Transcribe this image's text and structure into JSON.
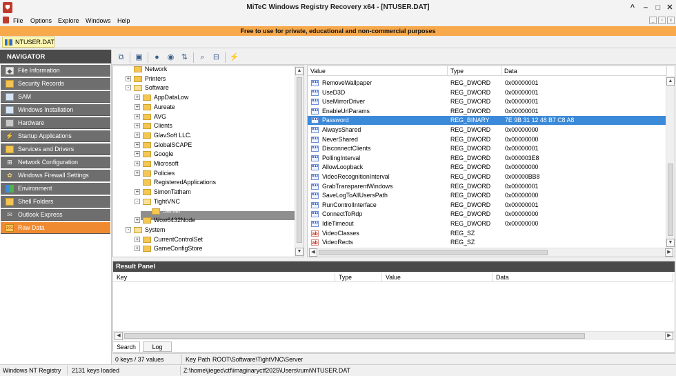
{
  "window": {
    "title": "MiTeC Windows Registry Recovery x64 - [NTUSER.DAT]"
  },
  "menu": [
    "File",
    "Options",
    "Explore",
    "Windows",
    "Help"
  ],
  "banner": "Free to use for private, educational and non-commercial purposes",
  "doc_tab": "NTUSER.DAT",
  "navigator": {
    "title": "NAVIGATOR",
    "items": [
      {
        "label": "File Information",
        "icon": "tag-icon"
      },
      {
        "label": "Security Records",
        "icon": "folder-icon"
      },
      {
        "label": "SAM",
        "icon": "sam-icon"
      },
      {
        "label": "Windows Installation",
        "icon": "monitor-icon"
      },
      {
        "label": "Hardware",
        "icon": "chip-icon"
      },
      {
        "label": "Startup Applications",
        "icon": "lightning-icon"
      },
      {
        "label": "Services and Drivers",
        "icon": "folder-icon"
      },
      {
        "label": "Network Configuration",
        "icon": "network-icon"
      },
      {
        "label": "Windows Firewall Settings",
        "icon": "firewall-icon"
      },
      {
        "label": "Environment",
        "icon": "windows-icon"
      },
      {
        "label": "Shell Folders",
        "icon": "folder-icon"
      },
      {
        "label": "Outlook Express",
        "icon": "mail-icon"
      },
      {
        "label": "Raw Data",
        "icon": "binary-icon",
        "active": true
      }
    ]
  },
  "tree": {
    "rows": [
      {
        "label": "Network",
        "indent": 0,
        "expander": "",
        "open": false
      },
      {
        "label": "Printers",
        "indent": 0,
        "expander": "+",
        "open": false
      },
      {
        "label": "Software",
        "indent": 0,
        "expander": "-",
        "open": true
      },
      {
        "label": "AppDataLow",
        "indent": 1,
        "expander": "+",
        "open": false
      },
      {
        "label": "Aureate",
        "indent": 1,
        "expander": "+",
        "open": false
      },
      {
        "label": "AVG",
        "indent": 1,
        "expander": "+",
        "open": false
      },
      {
        "label": "Clients",
        "indent": 1,
        "expander": "+",
        "open": false
      },
      {
        "label": "GlavSoft LLC.",
        "indent": 1,
        "expander": "+",
        "open": false
      },
      {
        "label": "GlobalSCAPE",
        "indent": 1,
        "expander": "+",
        "open": false
      },
      {
        "label": "Google",
        "indent": 1,
        "expander": "+",
        "open": false
      },
      {
        "label": "Microsoft",
        "indent": 1,
        "expander": "+",
        "open": false
      },
      {
        "label": "Policies",
        "indent": 1,
        "expander": "+",
        "open": false
      },
      {
        "label": "RegisteredApplications",
        "indent": 1,
        "expander": "",
        "open": false
      },
      {
        "label": "SimonTatham",
        "indent": 1,
        "expander": "+",
        "open": false
      },
      {
        "label": "TightVNC",
        "indent": 1,
        "expander": "-",
        "open": true
      },
      {
        "label": "Server",
        "indent": 2,
        "expander": "",
        "open": false,
        "selected": true
      },
      {
        "label": "Wow6432Node",
        "indent": 1,
        "expander": "+",
        "open": false
      },
      {
        "label": "System",
        "indent": 0,
        "expander": "-",
        "open": true
      },
      {
        "label": "CurrentControlSet",
        "indent": 1,
        "expander": "+",
        "open": false
      },
      {
        "label": "GameConfigStore",
        "indent": 1,
        "expander": "+",
        "open": false
      }
    ]
  },
  "values": {
    "columns": [
      "Value",
      "Type",
      "Data"
    ],
    "rows": [
      {
        "name": "RemoveWallpaper",
        "type": "REG_DWORD",
        "data": "0x00000001",
        "icon": "binary-value-icon"
      },
      {
        "name": "UseD3D",
        "type": "REG_DWORD",
        "data": "0x00000001",
        "icon": "binary-value-icon"
      },
      {
        "name": "UseMirrorDriver",
        "type": "REG_DWORD",
        "data": "0x00000001",
        "icon": "binary-value-icon"
      },
      {
        "name": "EnableUrlParams",
        "type": "REG_DWORD",
        "data": "0x00000001",
        "icon": "binary-value-icon"
      },
      {
        "name": "Password",
        "type": "REG_BINARY",
        "data": "7E 9B 31 12 48 B7 C8 A8",
        "icon": "binary-value-icon",
        "selected": true
      },
      {
        "name": "AlwaysShared",
        "type": "REG_DWORD",
        "data": "0x00000000",
        "icon": "binary-value-icon"
      },
      {
        "name": "NeverShared",
        "type": "REG_DWORD",
        "data": "0x00000000",
        "icon": "binary-value-icon"
      },
      {
        "name": "DisconnectClients",
        "type": "REG_DWORD",
        "data": "0x00000001",
        "icon": "binary-value-icon"
      },
      {
        "name": "PollingInterval",
        "type": "REG_DWORD",
        "data": "0x000003E8",
        "icon": "binary-value-icon"
      },
      {
        "name": "AllowLoopback",
        "type": "REG_DWORD",
        "data": "0x00000000",
        "icon": "binary-value-icon"
      },
      {
        "name": "VideoRecognitionInterval",
        "type": "REG_DWORD",
        "data": "0x00000BB8",
        "icon": "binary-value-icon"
      },
      {
        "name": "GrabTransparentWindows",
        "type": "REG_DWORD",
        "data": "0x00000001",
        "icon": "binary-value-icon"
      },
      {
        "name": "SaveLogToAllUsersPath",
        "type": "REG_DWORD",
        "data": "0x00000000",
        "icon": "binary-value-icon"
      },
      {
        "name": "RunControlInterface",
        "type": "REG_DWORD",
        "data": "0x00000001",
        "icon": "binary-value-icon"
      },
      {
        "name": "ConnectToRdp",
        "type": "REG_DWORD",
        "data": "0x00000000",
        "icon": "binary-value-icon"
      },
      {
        "name": "IdleTimeout",
        "type": "REG_DWORD",
        "data": "0x00000000",
        "icon": "binary-value-icon"
      },
      {
        "name": "VideoClasses",
        "type": "REG_SZ",
        "data": "",
        "icon": "string-value-icon"
      },
      {
        "name": "VideoRects",
        "type": "REG_SZ",
        "data": "",
        "icon": "string-value-icon"
      }
    ]
  },
  "result_panel": {
    "title": "Result Panel",
    "columns": [
      "Key",
      "Type",
      "Value",
      "Data"
    ],
    "tabs": [
      "Search",
      "Log"
    ]
  },
  "info": {
    "count": "0 keys / 37 values",
    "keypath_label": "Key Path",
    "keypath": "ROOT\\Software\\TightVNC\\Server"
  },
  "status": {
    "os": "Windows NT Registry",
    "keys": "2131 keys loaded",
    "path": "Z:\\home\\jiegec\\ctf\\imaginaryctf2025\\Users\\rumi\\NTUSER.DAT"
  },
  "colors": {
    "banner": "#f7a94b",
    "nav_active": "#f08a31",
    "nav_item": "#6e6e6e",
    "selection": "#3b8ad9"
  }
}
